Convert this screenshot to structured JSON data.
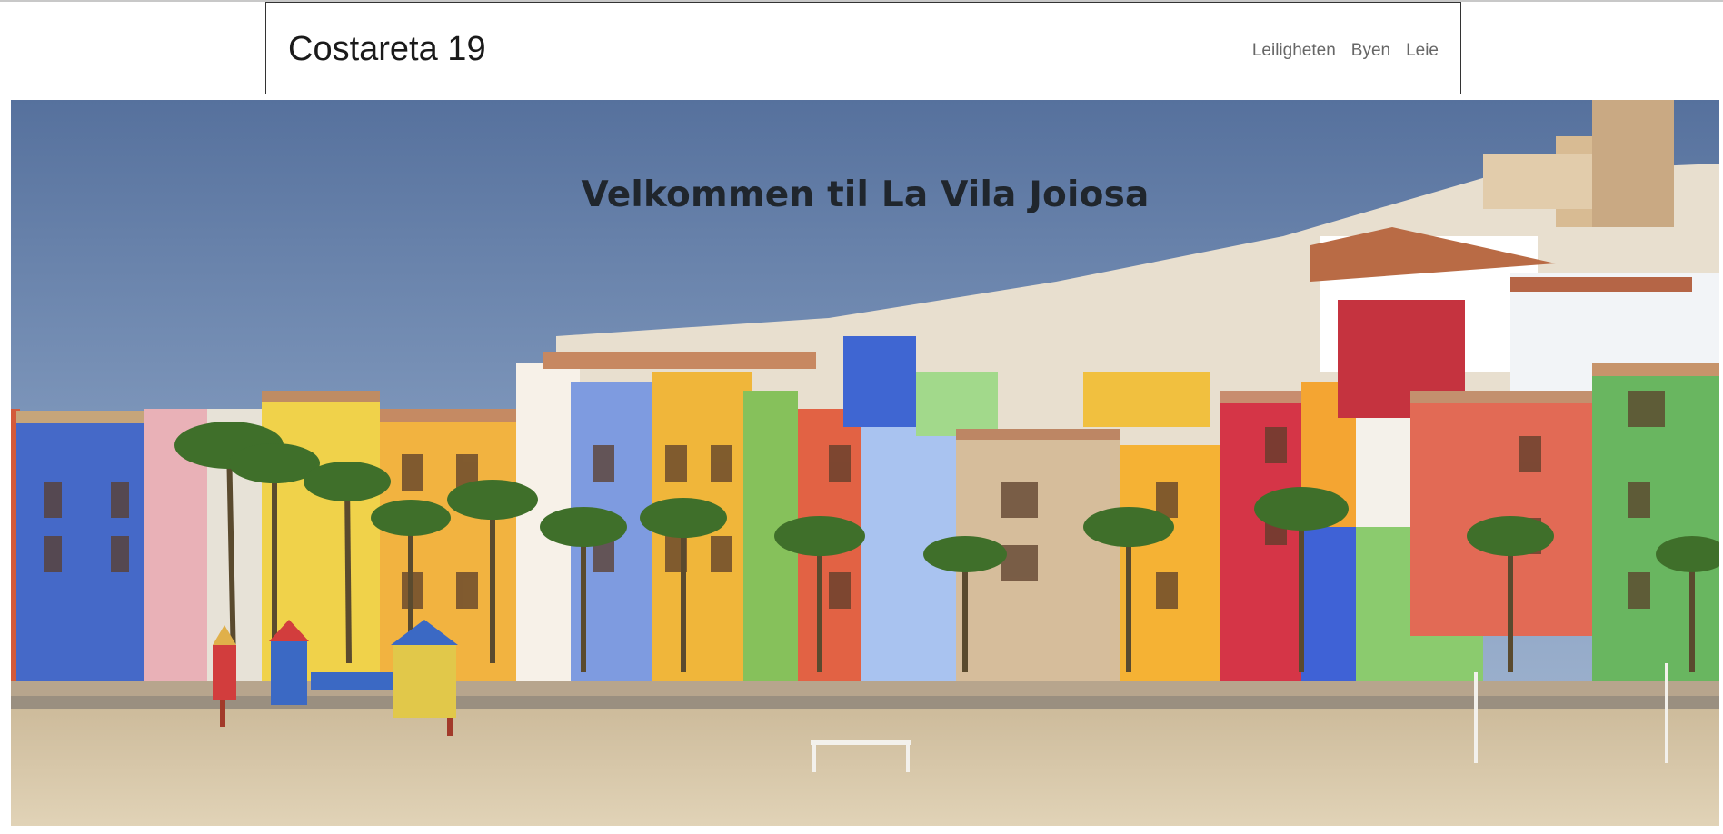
{
  "site": {
    "brand": "Costareta 19"
  },
  "nav": {
    "items": [
      {
        "label": "Leiligheten"
      },
      {
        "label": "Byen"
      },
      {
        "label": "Leie"
      }
    ]
  },
  "hero": {
    "title": "Velkommen til La Vila Joiosa",
    "image_alt": "colorful-houses-beach-photo"
  },
  "colors": {
    "sky_top": "#55709c",
    "sky_bottom": "#8ea6c8",
    "sand": "#d9c9ab",
    "title": "#20262d",
    "border": "#333333"
  }
}
